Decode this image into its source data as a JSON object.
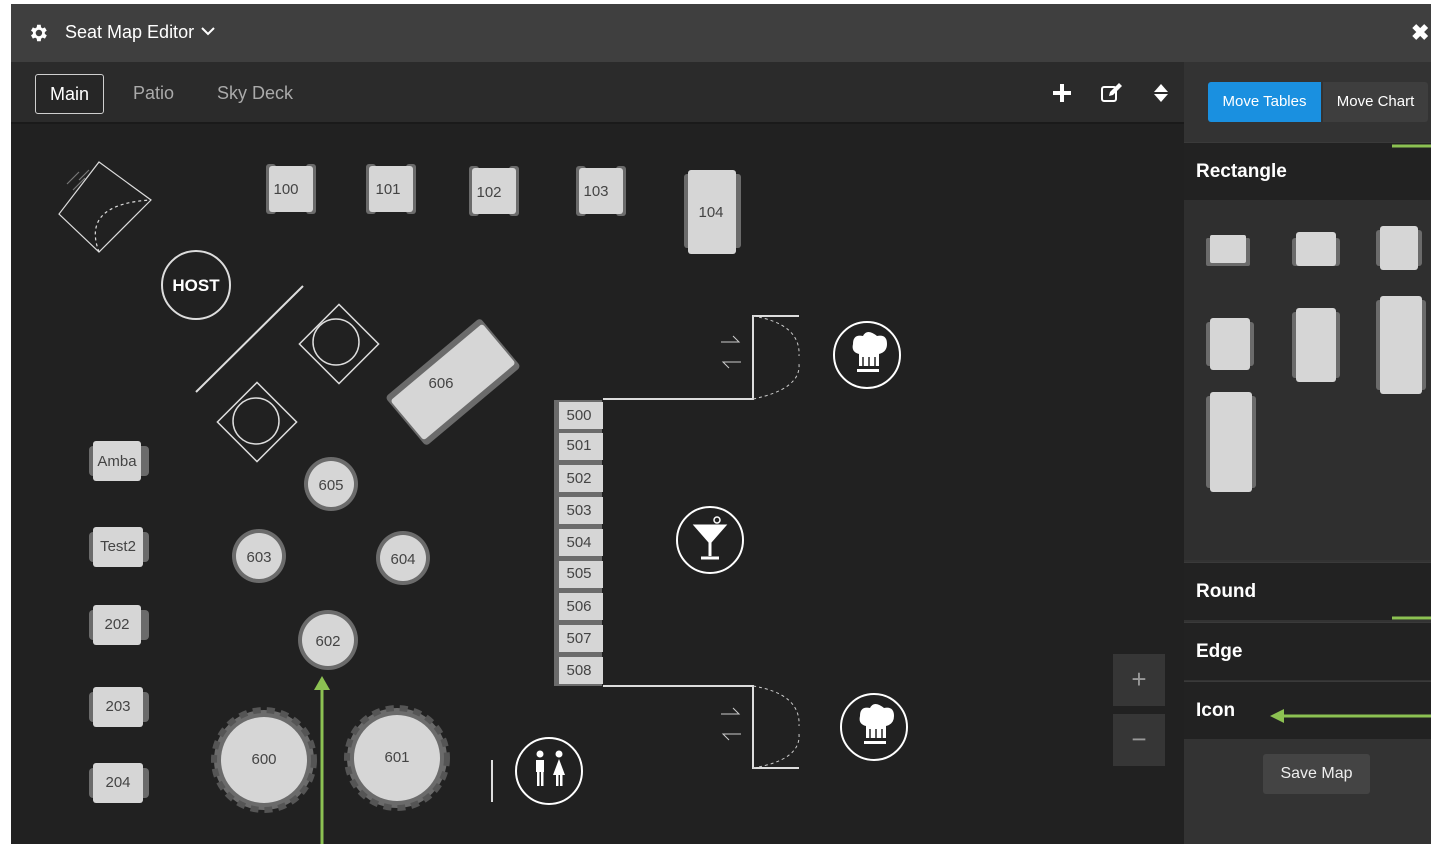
{
  "header": {
    "title": "Seat Map Editor",
    "close_label": "✖"
  },
  "tabs": [
    {
      "label": "Main",
      "active": true
    },
    {
      "label": "Patio"
    },
    {
      "label": "Sky Deck"
    }
  ],
  "toolbar": {
    "add_icon": "plus-icon",
    "edit_icon": "edit-icon",
    "sort_icon": "sort-icon"
  },
  "sidebar": {
    "move_tables": "Move Tables",
    "move_chart": "Move Chart",
    "sections": {
      "rectangle": "Rectangle",
      "round": "Round",
      "edge": "Edge",
      "icon": "Icon"
    },
    "save_map": "Save Map"
  },
  "zoom": {
    "in": "+",
    "out": "−"
  },
  "map": {
    "host_label": "HOST",
    "tables": {
      "t100": "100",
      "t101": "101",
      "t102": "102",
      "t103": "103",
      "t104": "104",
      "t606": "606",
      "t605": "605",
      "t603": "603",
      "t604": "604",
      "t602": "602",
      "t600": "600",
      "t601": "601",
      "amba": "Amba",
      "test2": "Test2",
      "t202": "202",
      "t203": "203",
      "t204": "204",
      "b500": "500",
      "b501": "501",
      "b502": "502",
      "b503": "503",
      "b504": "504",
      "b505": "505",
      "b506": "506",
      "b507": "507",
      "b508": "508"
    }
  },
  "colors": {
    "accent": "#1a90e0",
    "annotation": "#8cc152",
    "table_fill": "#d6d6d6",
    "chair": "#6b6b6b"
  }
}
